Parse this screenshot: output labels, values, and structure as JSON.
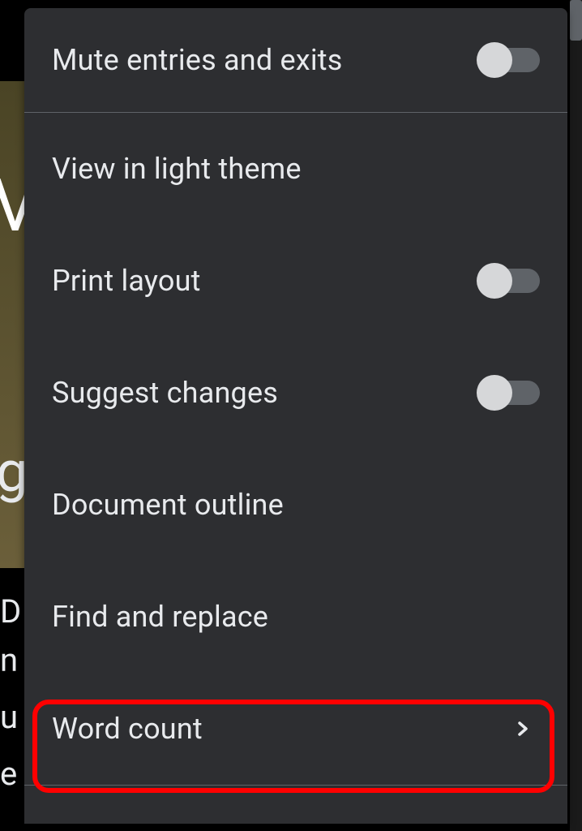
{
  "menu": {
    "items": [
      {
        "label": "Mute entries and exits",
        "has_toggle": true,
        "toggle_on": false
      },
      {
        "label": "View in light theme",
        "has_toggle": false
      },
      {
        "label": "Print layout",
        "has_toggle": true,
        "toggle_on": false
      },
      {
        "label": "Suggest changes",
        "has_toggle": true,
        "toggle_on": false
      },
      {
        "label": "Document outline",
        "has_toggle": false
      },
      {
        "label": "Find and replace",
        "has_toggle": false
      },
      {
        "label": "Word count",
        "has_toggle": false,
        "has_chevron": true
      }
    ]
  },
  "highlight": {
    "target": "word-count"
  }
}
